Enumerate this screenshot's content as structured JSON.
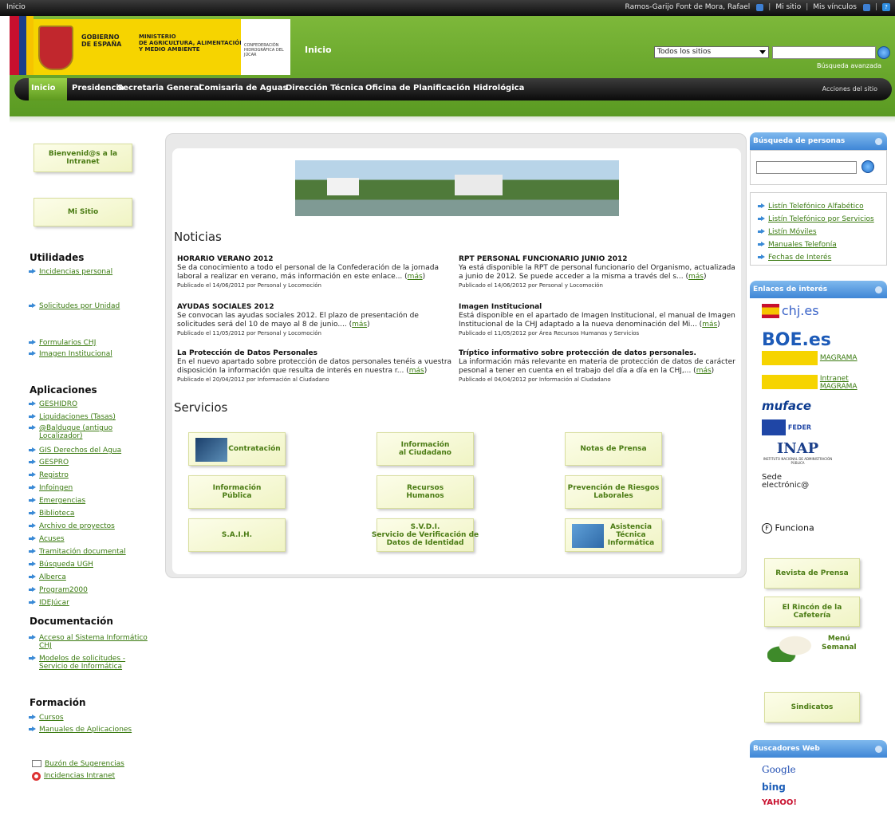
{
  "topbar": {
    "breadcrumb": "Inicio",
    "user": "Ramos-Garijo Font de Mora, Rafael",
    "my_site": "Mi sitio",
    "my_links": "Mis vínculos"
  },
  "header": {
    "gov_label": "GOBIERNO\nDE ESPAÑA",
    "ministry_label": "MINISTERIO\nDE AGRICULTURA, ALIMENTACIÓN\nY MEDIO AMBIENTE",
    "confed_label": "CONFEDERACIÓN HIDROGRÁFICA DEL JÚCAR",
    "site_title": "Inicio",
    "scope_select": "Todos los sitios",
    "search_value": "",
    "advanced_search": "Búsqueda avanzada"
  },
  "nav": {
    "items": [
      "Inicio",
      "Presidencia",
      "Secretaria General",
      "Comisaria de Aguas",
      "Dirección Técnica",
      "Oficina de Planificación Hidrológica"
    ],
    "actions": "Acciones del sitio"
  },
  "left": {
    "welcome": "Bienvenid@s a la Intranet",
    "my_site": "Mi Sitio",
    "utilidades_title": "Utilidades",
    "utilidades": [
      "Incidencias personal",
      "Solicitudes por Unidad",
      "Formularios CHJ",
      "Imagen Institucional"
    ],
    "aplicaciones_title": "Aplicaciones",
    "aplicaciones": [
      "GESHIDRO",
      "Liquidaciones (Tasas)",
      "@Balduque (antiguo Localizador)",
      "GIS Derechos del Agua",
      "GESPRO",
      "Registro",
      "Infoingen",
      "Emergencias",
      "Biblioteca",
      "Archivo de proyectos",
      "Acuses",
      "Tramitación documental",
      "Búsqueda UGH",
      "Alberca",
      "Program2000",
      "IDEJúcar"
    ],
    "documentacion_title": "Documentación",
    "documentacion": [
      "Acceso al Sistema Informático CHJ",
      "Modelos de solicitudes - Servicio de Informática"
    ],
    "formacion_title": "Formación",
    "formacion": [
      "Cursos",
      "Manuales de Aplicaciones"
    ],
    "buzon": "Buzón de Sugerencias",
    "incidencias_intranet": "Incidencias Intranet"
  },
  "center": {
    "news_title": "Noticias",
    "more_label": "más",
    "news": [
      {
        "title": "HORARIO VERANO 2012",
        "body": "Se da conocimiento a todo el personal de la Confederación de la jornada laboral a realizar en verano, más información en este enlace...",
        "meta": "Publicado el 14/06/2012 por Personal y Locomoción"
      },
      {
        "title": "RPT PERSONAL FUNCIONARIO JUNIO 2012",
        "body": "Ya está disponible la RPT de personal funcionario del Organismo, actualizada a junio de 2012. Se puede acceder a la misma a través del s...",
        "meta": "Publicado el 14/06/2012 por Personal y Locomoción"
      },
      {
        "title": "AYUDAS SOCIALES 2012",
        "body": "Se convocan las ayudas sociales 2012. El plazo de presentación de solicitudes será del 10 de mayo al 8 de junio....",
        "meta": "Publicado el 11/05/2012 por Personal y Locomoción"
      },
      {
        "title": "Imagen Institucional",
        "body": "Está disponible en el apartado de Imagen Institucional, el manual de Imagen Institucional de la CHJ adaptado a la nueva denominación del Mi...",
        "meta": "Publicado el 11/05/2012 por Área Recursos Humanos y Servicios"
      },
      {
        "title": "La Protección de Datos Personales",
        "body": "En el nuevo apartado sobre protección de datos personales tenéis a vuestra disposición la información que resulta de interés en nuestra r...",
        "meta": "Publicado el 20/04/2012 por Información al Ciudadano"
      },
      {
        "title": "Tríptico informativo sobre protección de datos personales.",
        "body": "La información más relevante en materia de protección de datos de carácter pesonal a tener en cuenta en el trabajo del día a día en la CHJ,...",
        "meta": "Publicado el 04/04/2012 por Información al Ciudadano"
      }
    ],
    "services_title": "Servicios",
    "services": [
      "Contratación",
      "Información\nal Ciudadano",
      "Notas de Prensa",
      "Información\nPública",
      "Recursos\nHumanos",
      "Prevención de Riesgos\nLaborales",
      "S.A.I.H.",
      "S.V.D.I.\nServicio de Verificación de\nDatos de Identidad",
      "Asistencia\nTécnica\nInformática"
    ]
  },
  "right": {
    "people_search_title": "Búsqueda de personas",
    "people_search_value": "",
    "phone_links": [
      "Listín Telefónico Alfabético",
      "Listín Telefónico por Servicios",
      "Listín Móviles",
      "Manuales Telefonía",
      "Fechas de Interés"
    ],
    "interest_title": "Enlaces de interés",
    "interest_links": {
      "chj": "chj.es",
      "boe": "BOE.es",
      "magrama": "MAGRAMA",
      "intranet_magrama": "Intranet\nMAGRAMA",
      "muface": "muface",
      "feder": "FEDER",
      "inap": "INAP",
      "inap_sub": "INSTITUTO NACIONAL DE ADMINISTRACIÓN PÚBLICA",
      "sede": "Sede\nelectrónic@",
      "funciona": "Funciona"
    },
    "revista": "Revista de Prensa",
    "cafeteria": "El Rincón de la Cafetería",
    "menu": "Menú\nSemanal",
    "sindicatos": "Sindicatos",
    "web_search_title": "Buscadores Web",
    "engines": [
      "Google",
      "bing",
      "YAHOO!"
    ]
  },
  "colors": {
    "header_green": "#6aa82c",
    "link_green": "#3a7a10",
    "panel_blue": "#4f91d9"
  }
}
